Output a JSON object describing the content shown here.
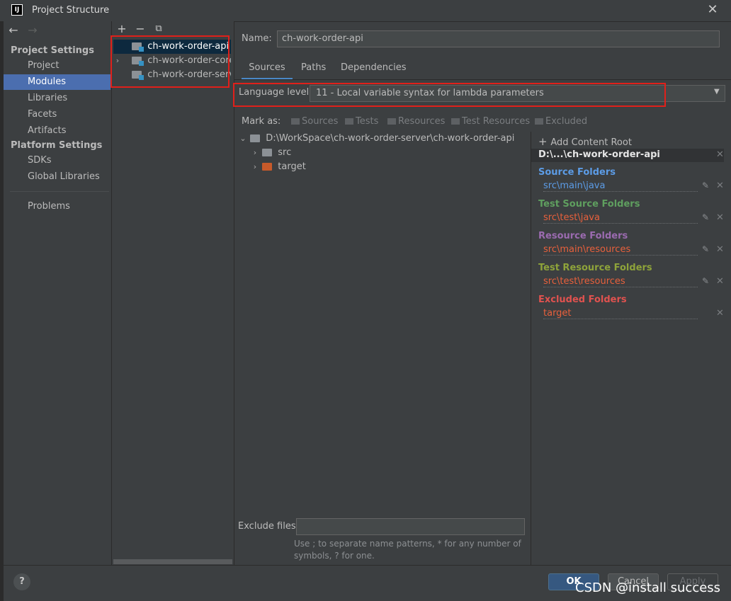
{
  "window": {
    "title": "Project Structure",
    "logo_text": "IJ",
    "close_icon": "✕"
  },
  "nav": {
    "back_icon": "←",
    "forward_icon": "→"
  },
  "sidebar": {
    "project_settings_title": "Project Settings",
    "project_items": [
      "Project",
      "Modules",
      "Libraries",
      "Facets",
      "Artifacts"
    ],
    "platform_settings_title": "Platform Settings",
    "platform_items": [
      "SDKs",
      "Global Libraries"
    ],
    "problems": "Problems",
    "selected": "Modules"
  },
  "modules": {
    "toolbar": {
      "add": "+",
      "remove": "−",
      "copy": "⧉"
    },
    "items": [
      {
        "label": "ch-work-order-api",
        "selected": true,
        "expandable": false
      },
      {
        "label": "ch-work-order-core",
        "selected": false,
        "expandable": true
      },
      {
        "label": "ch-work-order-server",
        "selected": false,
        "expandable": false
      }
    ]
  },
  "detail": {
    "name_label": "Name:",
    "name_value": "ch-work-order-api",
    "tabs": [
      "Sources",
      "Paths",
      "Dependencies"
    ],
    "active_tab": "Sources",
    "language_label": "Language level:",
    "language_value": "11 - Local variable syntax for lambda parameters",
    "mark_as_label": "Mark as:",
    "mark_as_options": [
      "Sources",
      "Tests",
      "Resources",
      "Test Resources",
      "Excluded"
    ],
    "tree": {
      "root": "D:\\WorkSpace\\ch-work-order-server\\ch-work-order-api",
      "children": [
        {
          "label": "src",
          "color": "#8c9196"
        },
        {
          "label": "target",
          "color": "#c75a2a"
        }
      ]
    },
    "exclude_label": "Exclude files:",
    "exclude_value": "",
    "exclude_hint": "Use ; to separate name patterns, * for any number of symbols, ? for one."
  },
  "roots": {
    "add_label": "Add Content Root",
    "root_path": "D:\\...\\ch-work-order-api",
    "groups": [
      {
        "title": "Source Folders",
        "path": "src\\main\\java",
        "title_color": "#5c9ce6",
        "path_color": "#5c9ce6",
        "editable": true
      },
      {
        "title": "Test Source Folders",
        "path": "src\\test\\java",
        "title_color": "#5f9f5f",
        "path_color": "#e8603c",
        "editable": true
      },
      {
        "title": "Resource Folders",
        "path": "src\\main\\resources",
        "title_color": "#9b6bb0",
        "path_color": "#e8603c",
        "editable": true
      },
      {
        "title": "Test Resource Folders",
        "path": "src\\test\\resources",
        "title_color": "#8ea33a",
        "path_color": "#e8603c",
        "editable": true
      },
      {
        "title": "Excluded Folders",
        "path": "target",
        "title_color": "#e0524f",
        "path_color": "#e8603c",
        "editable": false
      }
    ]
  },
  "buttons": {
    "help": "?",
    "ok": "OK",
    "cancel": "Cancel",
    "apply": "Apply"
  },
  "watermark": "CSDN @install success"
}
